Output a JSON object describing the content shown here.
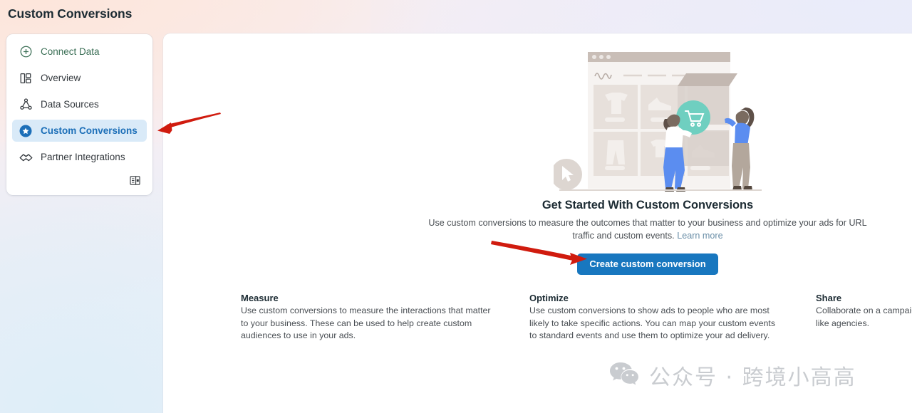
{
  "page": {
    "title": "Custom Conversions"
  },
  "sidebar": {
    "items": [
      {
        "label": "Connect Data",
        "icon": "plus-circle-icon",
        "style": "green",
        "active": false
      },
      {
        "label": "Overview",
        "icon": "layout-panels-icon",
        "style": "normal",
        "active": false
      },
      {
        "label": "Data Sources",
        "icon": "data-sources-network-icon",
        "style": "normal",
        "active": false
      },
      {
        "label": "Custom Conversions",
        "icon": "star-circle-icon",
        "style": "normal",
        "active": true
      },
      {
        "label": "Partner Integrations",
        "icon": "handshake-icon",
        "style": "normal",
        "active": false
      }
    ],
    "collapse_icon": "collapse-sidebar-icon"
  },
  "hero": {
    "illustration_name": "storefront-shopping-illustration",
    "title": "Get Started With Custom Conversions",
    "description": "Use custom conversions to measure the outcomes that matter to your business and optimize your ads for URL traffic and custom events.",
    "learn_more": "Learn more",
    "cta_label": "Create custom conversion"
  },
  "features": [
    {
      "title": "Measure",
      "body": "Use custom conversions to measure the interactions that matter to your business. These can be used to help create custom audiences to use in your ads."
    },
    {
      "title": "Optimize",
      "body": "Use custom conversions to show ads to people who are most likely to take specific actions. You can map your custom events to standard events and use them to optimize your ad delivery."
    },
    {
      "title": "Share",
      "body": "Collaborate on a campaign with other ad or business accounts, like agencies."
    }
  ],
  "watermark": {
    "icon": "wechat-icon",
    "text": "公众号 · 跨境小高高"
  },
  "annotations": [
    {
      "name": "arrow-pointing-to-custom-conversions-nav",
      "color": "#d01b0e"
    },
    {
      "name": "arrow-pointing-to-create-custom-conversion-button",
      "color": "#d01b0e"
    }
  ],
  "colors": {
    "accent_blue": "#1877bf",
    "active_nav_bg": "#d9eaf8",
    "active_nav_text": "#1c6fb8",
    "connect_data_green": "#3b6f56",
    "annotation_red": "#d01b0e",
    "link_blue": "#6b8fa8"
  }
}
